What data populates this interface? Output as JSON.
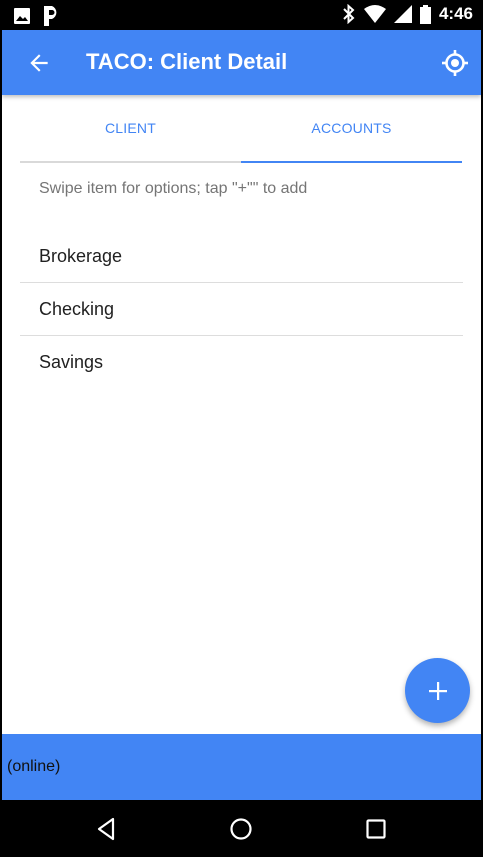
{
  "status_bar": {
    "time": "4:46",
    "icons": [
      "image-icon",
      "parking-icon",
      "bluetooth-icon",
      "wifi-icon",
      "cell-signal-icon",
      "battery-icon"
    ]
  },
  "app_bar": {
    "title": "TACO: Client Detail",
    "nav_icon": "back-arrow-icon",
    "action_icon": "location-icon"
  },
  "tabs": [
    {
      "label": "CLIENT",
      "selected": false
    },
    {
      "label": "ACCOUNTS",
      "selected": true
    }
  ],
  "hint": "Swipe item for options; tap \"+\"\" to add",
  "accounts": [
    {
      "label": "Brokerage"
    },
    {
      "label": "Checking"
    },
    {
      "label": "Savings"
    }
  ],
  "fab": {
    "icon": "plus-icon"
  },
  "footer": {
    "status": "(online)"
  },
  "nav_bar": {
    "buttons": [
      "back-icon",
      "home-icon",
      "recents-icon"
    ]
  },
  "colors": {
    "primary": "#4285f4",
    "text": "#212121",
    "hint": "#757575"
  }
}
